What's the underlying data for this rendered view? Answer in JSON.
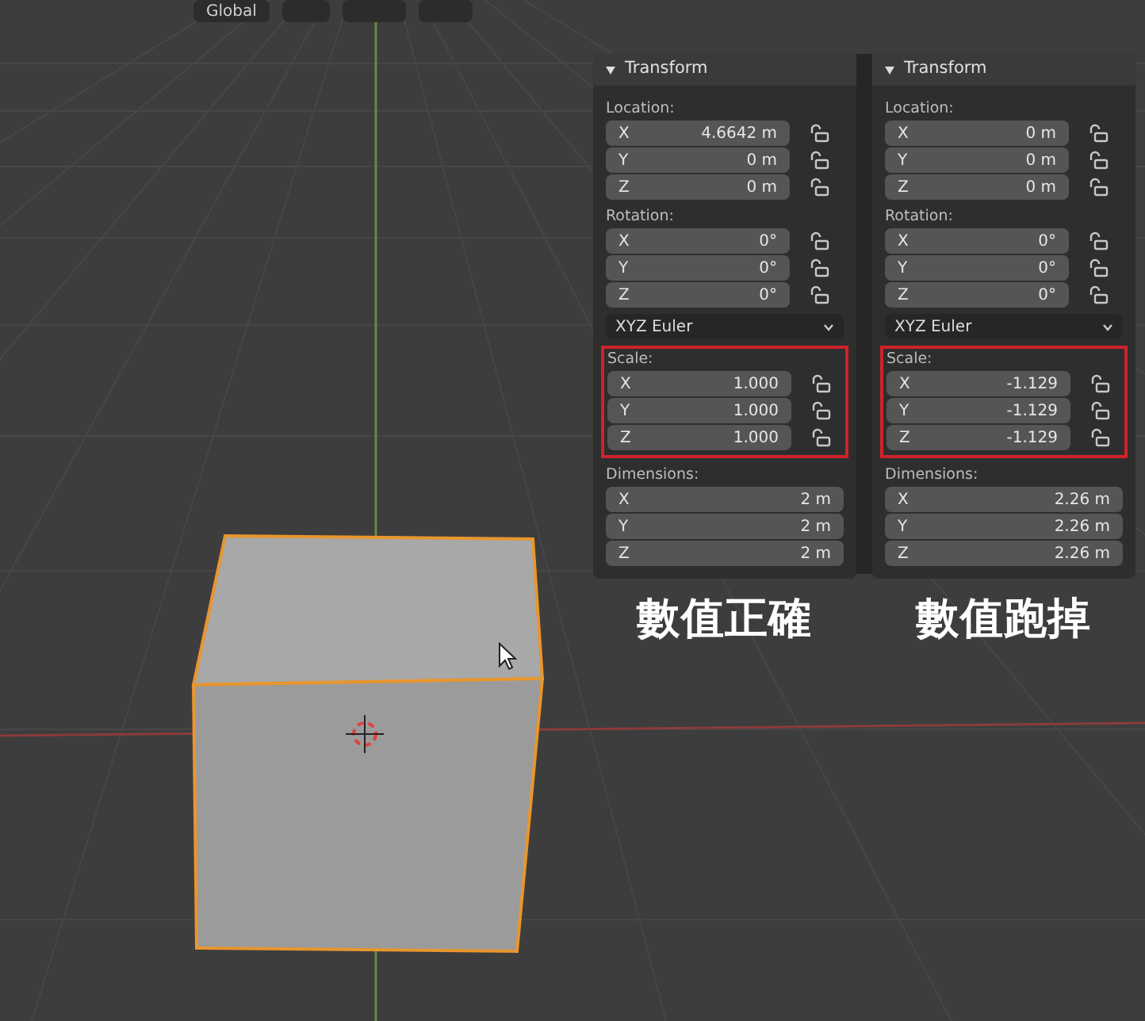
{
  "toolbar": {
    "orientation": "Global"
  },
  "panels": [
    {
      "title": "Transform",
      "sections": [
        {
          "kind": "vector",
          "label": "Location:",
          "locks": true,
          "highlighted": false,
          "rows": [
            {
              "axis": "X",
              "value": "4.6642 m"
            },
            {
              "axis": "Y",
              "value": "0 m"
            },
            {
              "axis": "Z",
              "value": "0 m"
            }
          ]
        },
        {
          "kind": "vector",
          "label": "Rotation:",
          "locks": true,
          "highlighted": false,
          "rows": [
            {
              "axis": "X",
              "value": "0°"
            },
            {
              "axis": "Y",
              "value": "0°"
            },
            {
              "axis": "Z",
              "value": "0°"
            }
          ]
        },
        {
          "kind": "dropdown",
          "value": "XYZ Euler"
        },
        {
          "kind": "vector",
          "label": "Scale:",
          "locks": true,
          "highlighted": true,
          "rows": [
            {
              "axis": "X",
              "value": "1.000"
            },
            {
              "axis": "Y",
              "value": "1.000"
            },
            {
              "axis": "Z",
              "value": "1.000"
            }
          ]
        },
        {
          "kind": "vector",
          "label": "Dimensions:",
          "locks": false,
          "highlighted": false,
          "rows": [
            {
              "axis": "X",
              "value": "2 m"
            },
            {
              "axis": "Y",
              "value": "2 m"
            },
            {
              "axis": "Z",
              "value": "2 m"
            }
          ]
        }
      ],
      "caption": "數值正確"
    },
    {
      "title": "Transform",
      "sections": [
        {
          "kind": "vector",
          "label": "Location:",
          "locks": true,
          "highlighted": false,
          "rows": [
            {
              "axis": "X",
              "value": "0 m"
            },
            {
              "axis": "Y",
              "value": "0 m"
            },
            {
              "axis": "Z",
              "value": "0 m"
            }
          ]
        },
        {
          "kind": "vector",
          "label": "Rotation:",
          "locks": true,
          "highlighted": false,
          "rows": [
            {
              "axis": "X",
              "value": "0°"
            },
            {
              "axis": "Y",
              "value": "0°"
            },
            {
              "axis": "Z",
              "value": "0°"
            }
          ]
        },
        {
          "kind": "dropdown",
          "value": "XYZ Euler"
        },
        {
          "kind": "vector",
          "label": "Scale:",
          "locks": true,
          "highlighted": true,
          "rows": [
            {
              "axis": "X",
              "value": "-1.129"
            },
            {
              "axis": "Y",
              "value": "-1.129"
            },
            {
              "axis": "Z",
              "value": "-1.129"
            }
          ]
        },
        {
          "kind": "vector",
          "label": "Dimensions:",
          "locks": false,
          "highlighted": false,
          "rows": [
            {
              "axis": "X",
              "value": "2.26 m"
            },
            {
              "axis": "Y",
              "value": "2.26 m"
            },
            {
              "axis": "Z",
              "value": "2.26 m"
            }
          ]
        }
      ],
      "caption": "數值跑掉"
    }
  ]
}
